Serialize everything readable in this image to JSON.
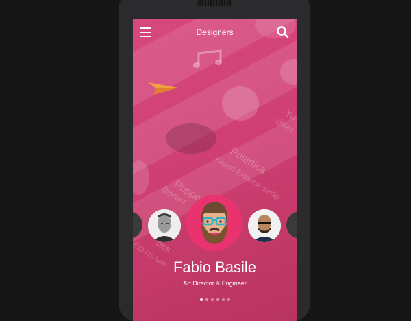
{
  "header": {
    "title": "Designers",
    "menu_icon": "hamburger-menu-icon",
    "search_icon": "search-icon"
  },
  "background_list": {
    "items": [
      {
        "name": "Polartica",
        "subtitle": "Airport Extreme config"
      },
      {
        "name": "Puppe",
        "subtitle": "@polart"
      },
      {
        "name": "Yu",
        "subtitle": "@nao"
      },
      {
        "name": "oss",
        "subtitle": "OO I'm late"
      }
    ]
  },
  "carousel": {
    "selected": {
      "name": "Fabio Basile",
      "role": "Art Director & Engineer"
    },
    "dots_total": 6,
    "dots_active": 0
  },
  "colors": {
    "screen_bg": "#cf3f73",
    "selected_ring": "#e8336e",
    "phone_body": "#2b2b2d",
    "page_bg": "#161616"
  }
}
